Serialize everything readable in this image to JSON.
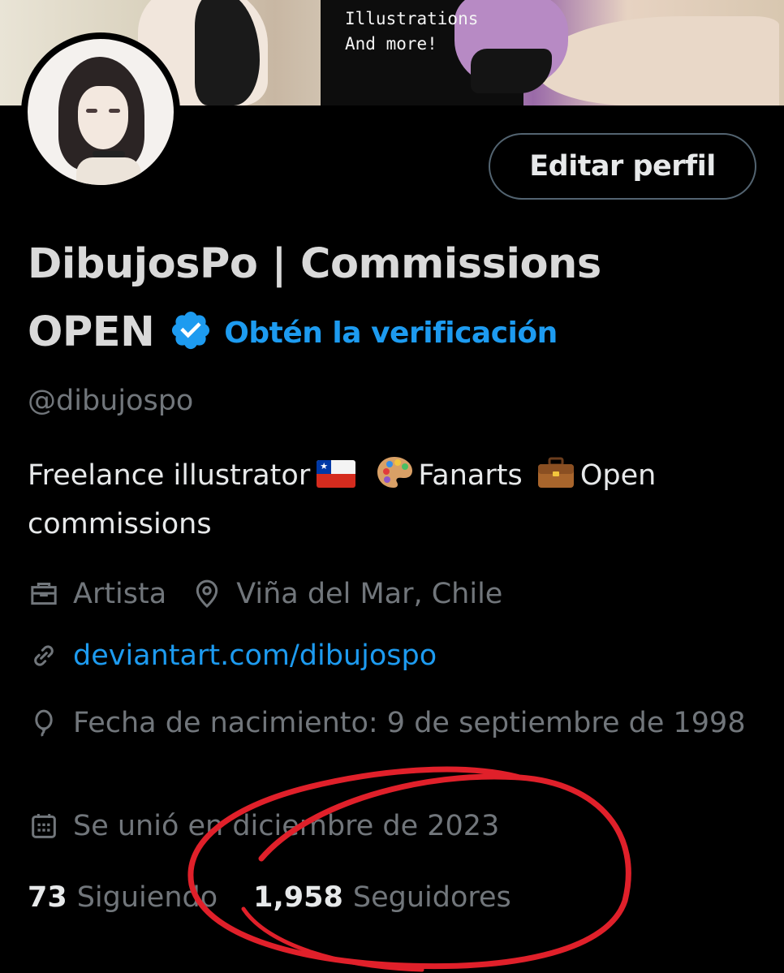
{
  "banner": {
    "text_lines": [
      "Illustrations",
      "And more!"
    ]
  },
  "profile": {
    "edit_button_label": "Editar perfil",
    "name_line1": "DibujosPo | Commissions",
    "name_line2": "OPEN",
    "get_verified_label": "Obtén la verificación",
    "handle": "@dibujospo",
    "bio": {
      "part1": "Freelance illustrator",
      "part2": "Fanarts",
      "part3": "Open commissions"
    },
    "profession": "Artista",
    "location": "Viña del Mar, Chile",
    "website": "deviantart.com/dibujospo",
    "birthdate": "Fecha de nacimiento: 9 de septiembre de 1998",
    "joined": "Se unió en diciembre de 2023",
    "following_count": "73",
    "following_label": "Siguiendo",
    "followers_count": "1,958",
    "followers_label": "Seguidores"
  },
  "colors": {
    "background": "#000000",
    "accent_blue": "#1d9bf0",
    "muted_text": "#71767b",
    "annotation_red": "#e0202a"
  },
  "icons": {
    "verified": "verified-badge-icon",
    "profession": "briefcase-icon",
    "location": "location-pin-icon",
    "website": "link-icon",
    "birthdate": "balloon-icon",
    "joined": "calendar-icon"
  }
}
